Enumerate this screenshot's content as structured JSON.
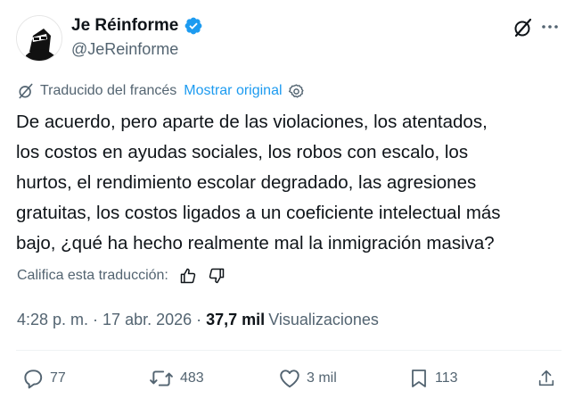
{
  "author": {
    "display_name": "Je Réinforme",
    "handle": "@JeReinforme"
  },
  "translation": {
    "translated_label": "Traducido del francés",
    "show_original": "Mostrar original"
  },
  "tweet": {
    "text": "De acuerdo, pero aparte de las violaciones, los atentados,\nlos costos en ayudas sociales, los robos con escalo, los\nhurtos, el rendimiento escolar degradado, las agresiones\ngratuitas, los costos ligados a un coeficiente intelectual más\nbajo, ¿qué ha hecho realmente mal la inmigración masiva?"
  },
  "rating": {
    "label": "Califica esta traducción:"
  },
  "meta": {
    "time": "4:28 p. m.",
    "separator": "·",
    "date": "17 abr. 2026",
    "views_count": "37,7 mil",
    "views_label": "Visualizaciones"
  },
  "actions": {
    "replies": "77",
    "reposts": "483",
    "likes": "3 mil",
    "bookmarks": "113"
  },
  "colors": {
    "accent": "#1d9bf0",
    "secondary_text": "#536471",
    "primary_text": "#0f1419"
  },
  "icons": [
    "verified-badge-icon",
    "grok-icon",
    "more-icon",
    "translate-icon",
    "settings-icon",
    "thumbs-up-icon",
    "thumbs-down-icon",
    "reply-icon",
    "repost-icon",
    "like-icon",
    "bookmark-icon",
    "share-icon"
  ]
}
